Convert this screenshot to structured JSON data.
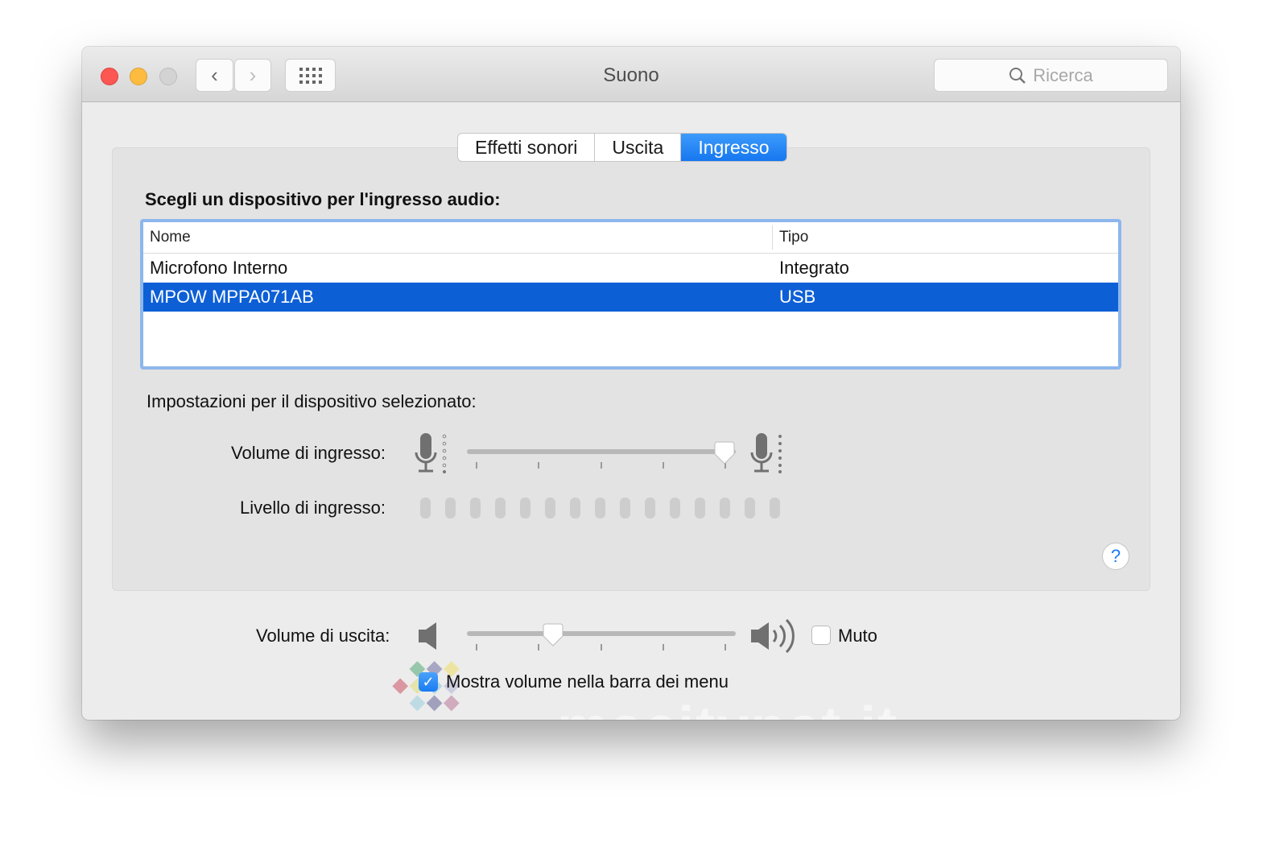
{
  "window": {
    "title": "Suono",
    "search_placeholder": "Ricerca"
  },
  "tabs": [
    {
      "label": "Effetti sonori"
    },
    {
      "label": "Uscita"
    },
    {
      "label": "Ingresso",
      "selected": true
    }
  ],
  "device_heading": "Scegli un dispositivo per l'ingresso audio:",
  "table": {
    "columns": [
      "Nome",
      "Tipo"
    ],
    "rows": [
      {
        "name": "Microfono Interno",
        "type": "Integrato"
      },
      {
        "name": "MPOW MPPA071AB",
        "type": "USB",
        "selected": true
      }
    ]
  },
  "settings_heading": "Impostazioni per il dispositivo selezionato:",
  "input_volume": {
    "label": "Volume di ingresso:",
    "value": 1.0
  },
  "input_level": {
    "label": "Livello di ingresso:",
    "segments": 15,
    "active": 0
  },
  "help": "?",
  "output_volume": {
    "label": "Volume di uscita:",
    "value": 0.31
  },
  "mute": {
    "label": "Muto",
    "checked": false
  },
  "show_in_menu": {
    "label": "Mostra volume nella barra dei menu",
    "checked": true
  },
  "watermark": "macitynet.it",
  "colors": {
    "accent": "#0d5fd6",
    "close": "#fc5753",
    "minimize": "#fdbc40"
  }
}
